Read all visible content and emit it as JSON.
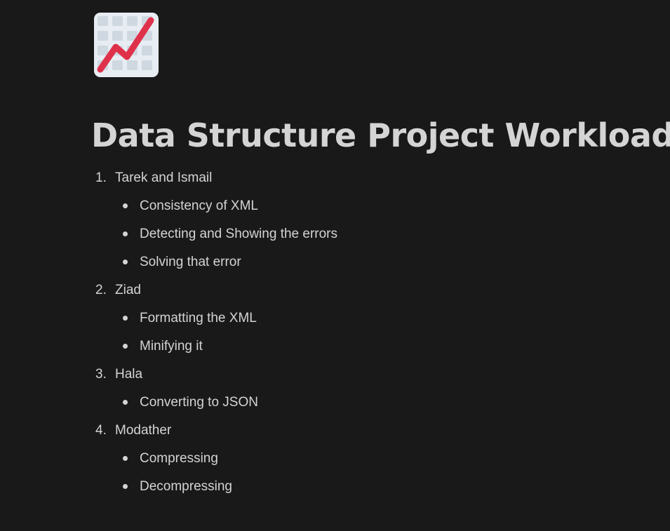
{
  "page": {
    "icon": "chart-increasing-icon",
    "title": "Data Structure Project Workload"
  },
  "colors": {
    "background": "#191919",
    "text": "#d4d4d4",
    "icon_line": "#e0314b",
    "icon_grid": "#cfd8e0"
  },
  "outline": [
    {
      "number": "1.",
      "label": "Tarek and Ismail",
      "children": [
        {
          "label": "Consistency of XML"
        },
        {
          "label": "Detecting and Showing the errors"
        },
        {
          "label": "Solving that error"
        }
      ]
    },
    {
      "number": "2.",
      "label": "Ziad",
      "children": [
        {
          "label": "Formatting the XML"
        },
        {
          "label": "Minifying it"
        }
      ]
    },
    {
      "number": "3.",
      "label": "Hala",
      "children": [
        {
          "label": "Converting to JSON"
        }
      ]
    },
    {
      "number": "4.",
      "label": "Modather",
      "children": [
        {
          "label": "Compressing"
        },
        {
          "label": "Decompressing"
        }
      ]
    }
  ]
}
